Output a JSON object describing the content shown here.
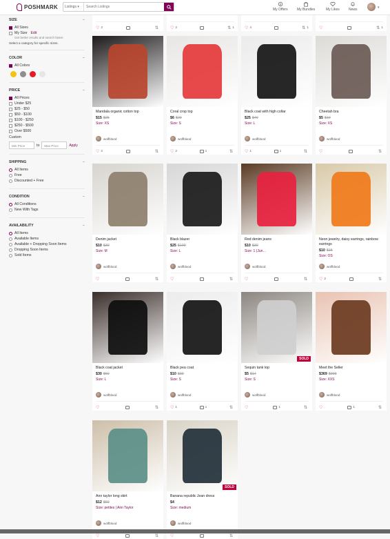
{
  "header": {
    "logo": "POSHMARK",
    "search_scope": "Listings",
    "search_placeholder": "Search Listings",
    "nav": [
      {
        "label": "My Offers"
      },
      {
        "label": "My Bundles"
      },
      {
        "label": "My Likes"
      },
      {
        "label": "News"
      }
    ]
  },
  "sidebar": {
    "size": {
      "title": "SIZE",
      "all_sizes": "All Sizes",
      "my_size": "My Size",
      "edit": "Edit",
      "hint": "Get better results and search faster.",
      "note": "Select a category for specific sizes."
    },
    "color": {
      "title": "COLOR",
      "all_colors": "All Colors",
      "swatches": [
        "#f2c318",
        "#8f8f8f",
        "#e41d25",
        "#e6e6e6"
      ]
    },
    "price": {
      "title": "PRICE",
      "options": [
        "All Prices",
        "Under $25",
        "$25 - $50",
        "$50 - $100",
        "$100 - $250",
        "$250 - $500",
        "Over $500"
      ],
      "custom": "Custom",
      "min": "Min Price",
      "to": "to",
      "max": "Max Price",
      "apply": "Apply"
    },
    "shipping": {
      "title": "SHIPPING",
      "options": [
        "All Items",
        "Free",
        "Discounted + Free"
      ]
    },
    "condition": {
      "title": "CONDITION",
      "options": [
        "All Conditions",
        "New With Tags"
      ]
    },
    "availability": {
      "title": "AVAILABILITY",
      "options": [
        "All Items",
        "Available Items",
        "Available + Dropping Soon Items",
        "Dropping Soon Items",
        "Sold Items"
      ]
    }
  },
  "partial_row": [
    {
      "likes": "2",
      "shares": ""
    },
    {
      "likes": "2",
      "shares": "1"
    },
    {
      "likes": "4",
      "shares": "1"
    },
    {
      "likes": "",
      "shares": "1"
    }
  ],
  "listings": [
    {
      "title": "Mandala organic cotton top",
      "price": "$15",
      "orig": "$25",
      "size": "Size: XS",
      "seller": "wolfblood",
      "likes": "2",
      "comments": "",
      "shares": "",
      "sold": false,
      "img": "#1e1a1c",
      "accent": "#b8452d"
    },
    {
      "title": "Coral crop top",
      "price": "$6",
      "orig": "$20",
      "size": "Size: S",
      "seller": "wolfblood",
      "likes": "2",
      "comments": "1",
      "shares": "",
      "sold": false,
      "img": "#e8e6e4",
      "accent": "#e5383b"
    },
    {
      "title": "Black coat with high collar",
      "price": "$25",
      "orig": "$40",
      "size": "Size: L",
      "seller": "wolfblood",
      "likes": "1",
      "comments": "1",
      "shares": "",
      "sold": false,
      "img": "#ebebeb",
      "accent": "#151515"
    },
    {
      "title": "Cheetah bra",
      "price": "$5",
      "orig": "$10",
      "size": "Size: XS",
      "seller": "wolfblood",
      "likes": "",
      "comments": "",
      "shares": "",
      "sold": false,
      "img": "#dcdbd7",
      "accent": "#6a5a55"
    },
    {
      "title": "Denim jacket",
      "price": "$10",
      "orig": "$30",
      "size": "Size: M",
      "seller": "wolfblood",
      "likes": "",
      "comments": "",
      "shares": "",
      "sold": false,
      "img": "#d7d4ce",
      "accent": "#8d7f6d"
    },
    {
      "title": "Black blazer",
      "price": "$25",
      "orig": "$100",
      "size": "Size: L",
      "seller": "wolfblood",
      "likes": "",
      "comments": "",
      "shares": "",
      "sold": false,
      "img": "#d6d6d6",
      "accent": "#1a1a1a"
    },
    {
      "title": "Red denim jeans",
      "price": "$10",
      "orig": "$30",
      "size": "Size: 1 (Jun…",
      "seller": "wolfblood",
      "likes": "",
      "comments": "",
      "shares": "",
      "sold": false,
      "img": "#5a3b24",
      "accent": "#e8213f"
    },
    {
      "title": "Neon jewelry, daisy earrings, rainbow earrings",
      "price": "$10",
      "orig": "$15",
      "size": "Size: OS",
      "seller": "wolfblood",
      "likes": "2",
      "comments": "",
      "shares": "",
      "sold": false,
      "img": "#d8c9a8",
      "accent": "#f07a1a"
    },
    {
      "title": "Black coat jacket",
      "price": "$30",
      "orig": "$60",
      "size": "Size: L",
      "seller": "wolfblood",
      "likes": "",
      "comments": "",
      "shares": "",
      "sold": false,
      "img": "#3a2e2a",
      "accent": "#0e0e0e"
    },
    {
      "title": "Black pea coat",
      "price": "$10",
      "orig": "$30",
      "size": "Size: S",
      "seller": "wolfblood",
      "likes": "1",
      "comments": "1",
      "shares": "",
      "sold": false,
      "img": "#ececec",
      "accent": "#131313"
    },
    {
      "title": "Sequin tank top",
      "price": "$5",
      "orig": "$14",
      "size": "Size: S",
      "seller": "wolfblood",
      "likes": "",
      "comments": "1",
      "shares": "",
      "sold": true,
      "img": "#8c8680",
      "accent": "#cfcfcf"
    },
    {
      "title": "Meet the Seller",
      "price": "$369",
      "orig": "$999",
      "size": "Size: XXS",
      "seller": "wolfblood",
      "likes": "",
      "comments": "1",
      "shares": "",
      "sold": false,
      "img": "#e9c3b2",
      "accent": "#6b3a20"
    },
    {
      "title": "Ann taylor long skirt",
      "price": "$12",
      "orig": "$60",
      "size": "Size: petites",
      "brand": "Ann Taylor",
      "seller": "wolfblood",
      "likes": "",
      "comments": "",
      "shares": "",
      "sold": false,
      "img": "#cdbfa9",
      "accent": "#5b8f88"
    },
    {
      "title": "Banana republic Jean dress",
      "price": "$4",
      "orig": "",
      "size": "Size: medium",
      "seller": "wolfblood",
      "likes": "",
      "comments": "",
      "shares": "",
      "sold": true,
      "img": "#d9d3c6",
      "accent": "#22303a"
    }
  ]
}
